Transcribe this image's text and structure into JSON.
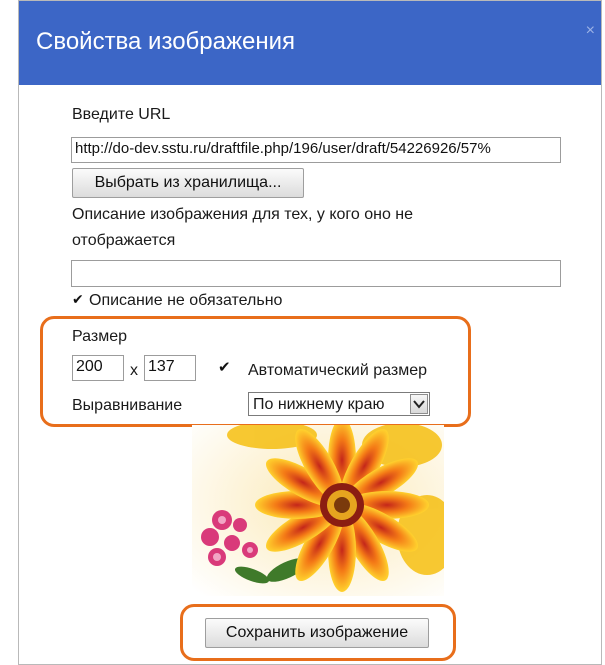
{
  "dialog": {
    "title": "Свойства изображения",
    "close_glyph": "×"
  },
  "url": {
    "label": "Введите URL",
    "value": "http://do-dev.sstu.ru/draftfile.php/196/user/draft/54226926/57%"
  },
  "browse_button_label": "Выбрать из хранилища...",
  "description": {
    "label_line1": "Описание изображения для тех, у кого оно не",
    "label_line2": "отображается",
    "value": ""
  },
  "description_optional": {
    "checked": true,
    "label": "Описание не обязательно"
  },
  "size": {
    "label": "Размер",
    "width": "200",
    "separator": "x",
    "height": "137",
    "auto_checked": true,
    "auto_label": "Автоматический размер"
  },
  "alignment": {
    "label": "Выравнивание",
    "selected": "По нижнему краю"
  },
  "save_button_label": "Сохранить изображение",
  "colors": {
    "title_bar": "#3c66c6",
    "highlight": "#e86e1b"
  }
}
